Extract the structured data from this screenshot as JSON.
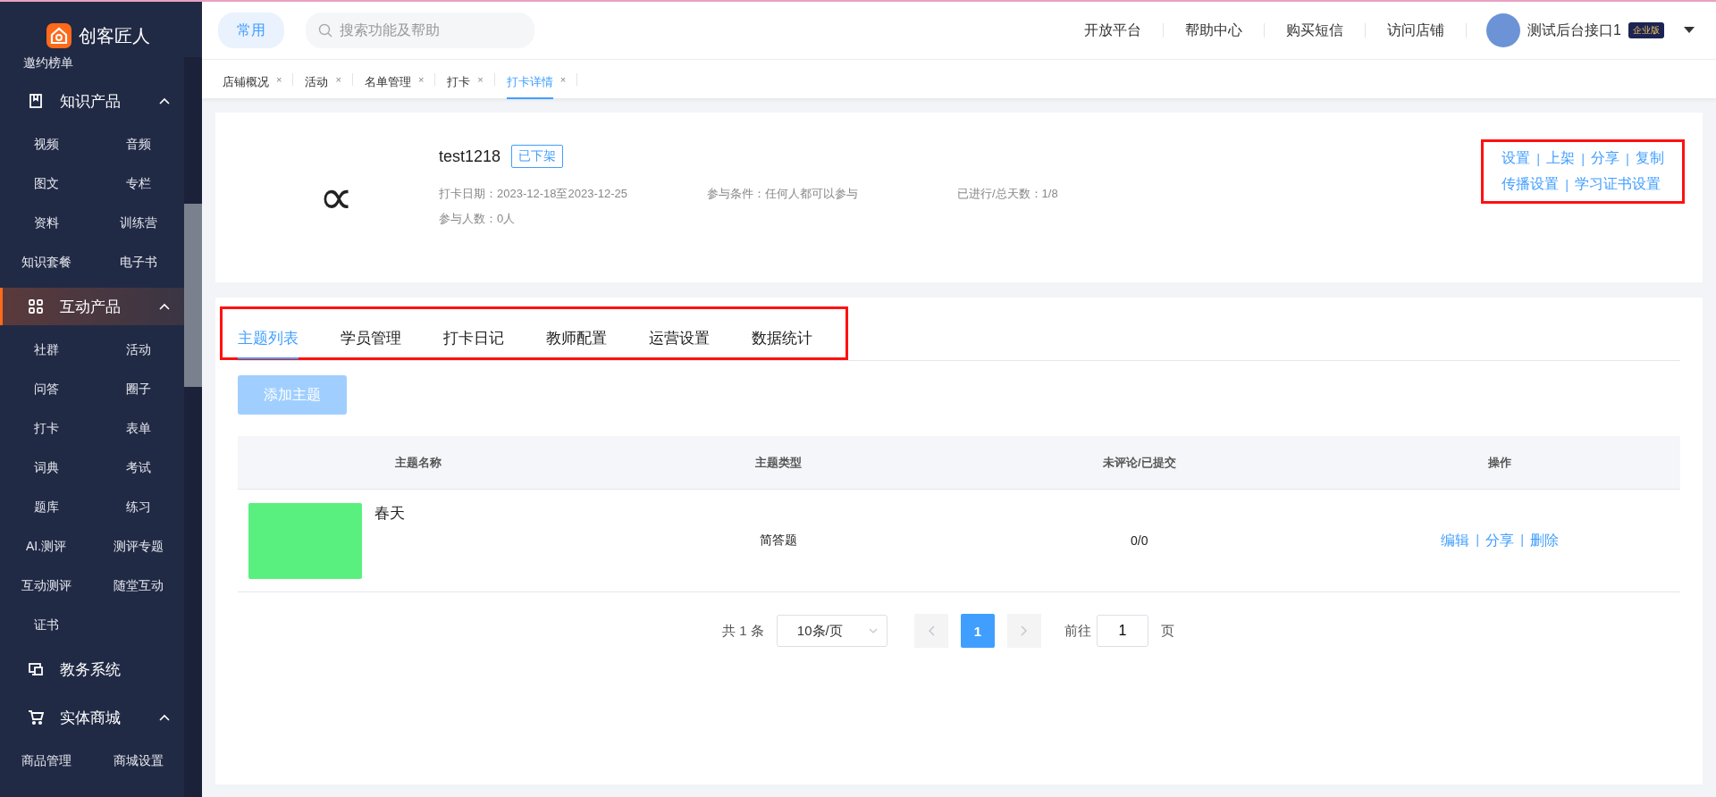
{
  "sidebar": {
    "brand": "创客匠人",
    "top_item": "邀约榜单",
    "groups": [
      {
        "label": "知识产品",
        "expanded": true,
        "active": false,
        "items": [
          "视频",
          "音频",
          "图文",
          "专栏",
          "资料",
          "训练营",
          "知识套餐",
          "电子书"
        ]
      },
      {
        "label": "互动产品",
        "expanded": true,
        "active": true,
        "items": [
          "社群",
          "活动",
          "问答",
          "圈子",
          "打卡",
          "表单",
          "词典",
          "考试",
          "题库",
          "练习",
          "AI.测评",
          "测评专题",
          "互动测评",
          "随堂互动",
          "证书"
        ]
      },
      {
        "label": "教务系统",
        "expanded": false,
        "active": false
      },
      {
        "label": "实体商城",
        "expanded": true,
        "active": false,
        "items": [
          "商品管理",
          "商城设置"
        ]
      }
    ]
  },
  "topbar": {
    "common_button": "常用",
    "search": {
      "placeholder": "搜索功能及帮助"
    },
    "links": [
      "开放平台",
      "帮助中心",
      "购买短信",
      "访问店铺"
    ],
    "user": "测试后台接口1",
    "badge": "企业版"
  },
  "page_tabs": [
    {
      "label": "店铺概况",
      "close": "×",
      "selected": false
    },
    {
      "label": "活动",
      "close": "×",
      "selected": false
    },
    {
      "label": "名单管理",
      "close": "×",
      "selected": false
    },
    {
      "label": "打卡",
      "close": "×",
      "selected": false
    },
    {
      "label": "打卡详情",
      "close": "×",
      "selected": true
    }
  ],
  "header": {
    "logo_char": "∝",
    "title": "test1218",
    "status": "已下架",
    "meta": [
      "打卡日期：2023-12-18至2023-12-25",
      "参与条件：任何人都可以参与",
      "已进行/总天数：1/8",
      "参与人数：0人"
    ],
    "actions_highlighted": true,
    "actions": [
      [
        {
          "kind": "link",
          "label": "设置"
        },
        {
          "kind": "sep",
          "label": "|"
        },
        {
          "kind": "link",
          "label": "上架"
        },
        {
          "kind": "sep",
          "label": "|"
        },
        {
          "kind": "link",
          "label": "分享"
        },
        {
          "kind": "sep",
          "label": "|"
        },
        {
          "kind": "link",
          "label": "复制"
        }
      ],
      [
        {
          "kind": "link",
          "label": "传播设置"
        },
        {
          "kind": "sep",
          "label": "|"
        },
        {
          "kind": "link",
          "label": "学习证书设置"
        }
      ]
    ]
  },
  "tabs_highlighted": true,
  "tabs": [
    {
      "label": "主题列表",
      "selected": true
    },
    {
      "label": "学员管理",
      "selected": false
    },
    {
      "label": "打卡日记",
      "selected": false
    },
    {
      "label": "教师配置",
      "selected": false
    },
    {
      "label": "运营设置",
      "selected": false
    },
    {
      "label": "数据统计",
      "selected": false
    }
  ],
  "add_button": {
    "label": "添加主题",
    "disabled": true
  },
  "table": {
    "columns": [
      "主题名称",
      "主题类型",
      "未评论/已提交",
      "操作"
    ],
    "rows": [
      {
        "name": "春天",
        "type": "简答题",
        "count": "0/0",
        "actions": [
          {
            "kind": "link",
            "label": "编辑"
          },
          {
            "kind": "sep",
            "label": "|"
          },
          {
            "kind": "link",
            "label": "分享"
          },
          {
            "kind": "sep",
            "label": "|"
          },
          {
            "kind": "link",
            "label": "删除"
          }
        ]
      }
    ]
  },
  "pagination": {
    "total": "共 1 条",
    "page_size": "10条/页",
    "pages": [
      {
        "label": "1",
        "selected": true
      }
    ],
    "goto_label": "前往",
    "goto_value": "1",
    "goto_suffix": "页"
  }
}
